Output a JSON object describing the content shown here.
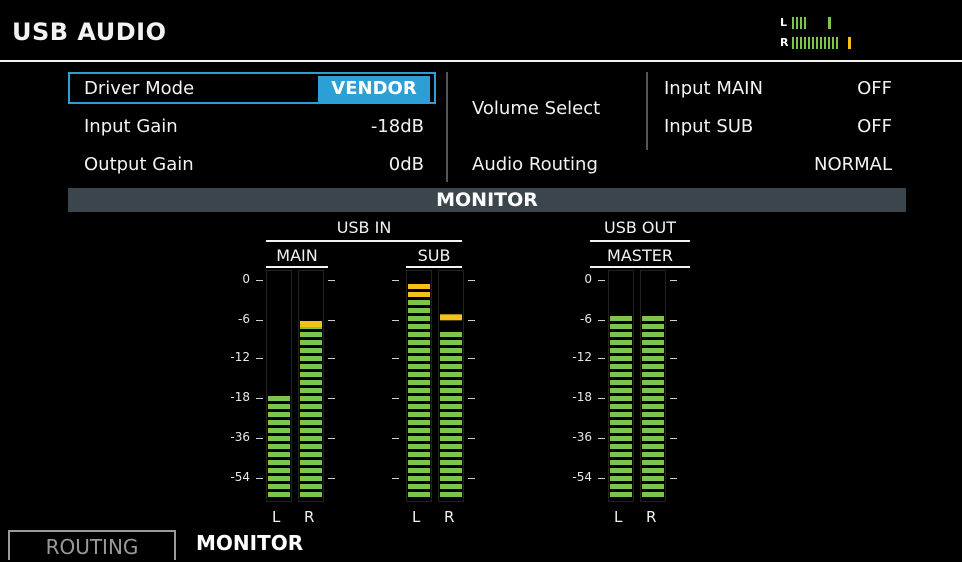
{
  "header": {
    "title": "USB AUDIO"
  },
  "mini_meter": {
    "left_label": "L",
    "right_label": "R",
    "left_level": 0.55,
    "right_level": 0.78
  },
  "params": {
    "driver_mode": {
      "label": "Driver Mode",
      "value": "VENDOR"
    },
    "input_gain": {
      "label": "Input Gain",
      "value": "-18dB"
    },
    "output_gain": {
      "label": "Output Gain",
      "value": "0dB"
    },
    "volume_select": {
      "label": "Volume Select"
    },
    "input_main": {
      "label": "Input MAIN",
      "value": "OFF"
    },
    "input_sub": {
      "label": "Input SUB",
      "value": "OFF"
    },
    "audio_routing": {
      "label": "Audio Routing",
      "value": "NORMAL"
    }
  },
  "monitor": {
    "title": "MONITOR",
    "usb_in_label": "USB IN",
    "usb_out_label": "USB OUT",
    "db_scale": [
      "0",
      "-6",
      "-12",
      "-18",
      "-36",
      "-54"
    ],
    "groups": {
      "main": {
        "label": "MAIN",
        "l": "L",
        "r": "R",
        "level_l_db": -18,
        "level_r_db": -6
      },
      "sub": {
        "label": "SUB",
        "l": "L",
        "r": "R",
        "level_l_db": -1,
        "level_r_db": -8
      },
      "master": {
        "label": "MASTER",
        "l": "L",
        "r": "R",
        "level_l_db": -6,
        "level_r_db": -6
      }
    },
    "peak_hold": {
      "main_r_db": -6,
      "sub_r_db": -5
    }
  },
  "tabs": {
    "routing": "ROUTING",
    "monitor": "MONITOR"
  },
  "colors": {
    "accent": "#2b9fd6",
    "meter_green": "#7cc44a",
    "meter_yellow": "#f2c21b",
    "band": "#3a464c"
  }
}
